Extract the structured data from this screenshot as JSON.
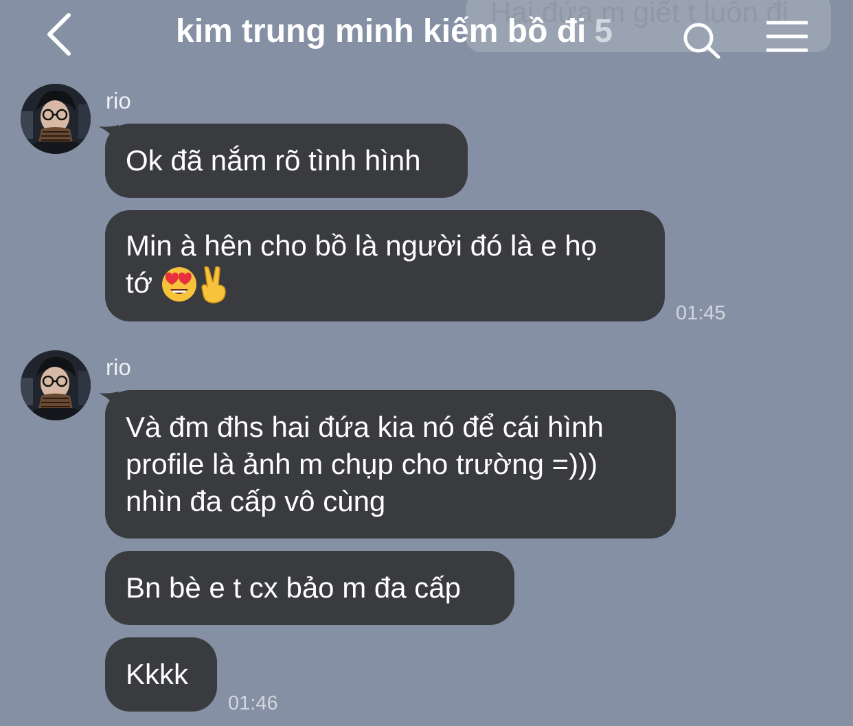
{
  "header": {
    "title": "kim trung minh kiếm bồ đi",
    "member_count": "5",
    "pinned_preview": "Hai đứa m giết t luôn đi",
    "back_icon": "chevron-left-icon",
    "search_icon": "search-icon",
    "menu_icon": "menu-icon"
  },
  "colors": {
    "background": "#8590a4",
    "bubble": "#3a3b3f",
    "text": "#ffffff",
    "timestamp": "#d2d6de"
  },
  "messages": {
    "groups": [
      {
        "sender": "rio",
        "bubbles": [
          {
            "text": "Ok đã nắm rõ tình hình"
          },
          {
            "text": "Min à hên cho bồ là người đó là e họ\ntớ",
            "emoji": [
              "heart-eyes-emoji",
              "victory-hand-emoji"
            ]
          }
        ],
        "time": "01:45"
      },
      {
        "sender": "rio",
        "bubbles": [
          {
            "text": "Và đm đhs hai đứa kia nó để cái hình\nprofile là ảnh m chụp cho trường =)))\nnhìn đa cấp vô cùng"
          },
          {
            "text": "Bn bè e t cx bảo m đa cấp"
          },
          {
            "text": "Kkkk"
          }
        ],
        "time": "01:46"
      }
    ]
  }
}
